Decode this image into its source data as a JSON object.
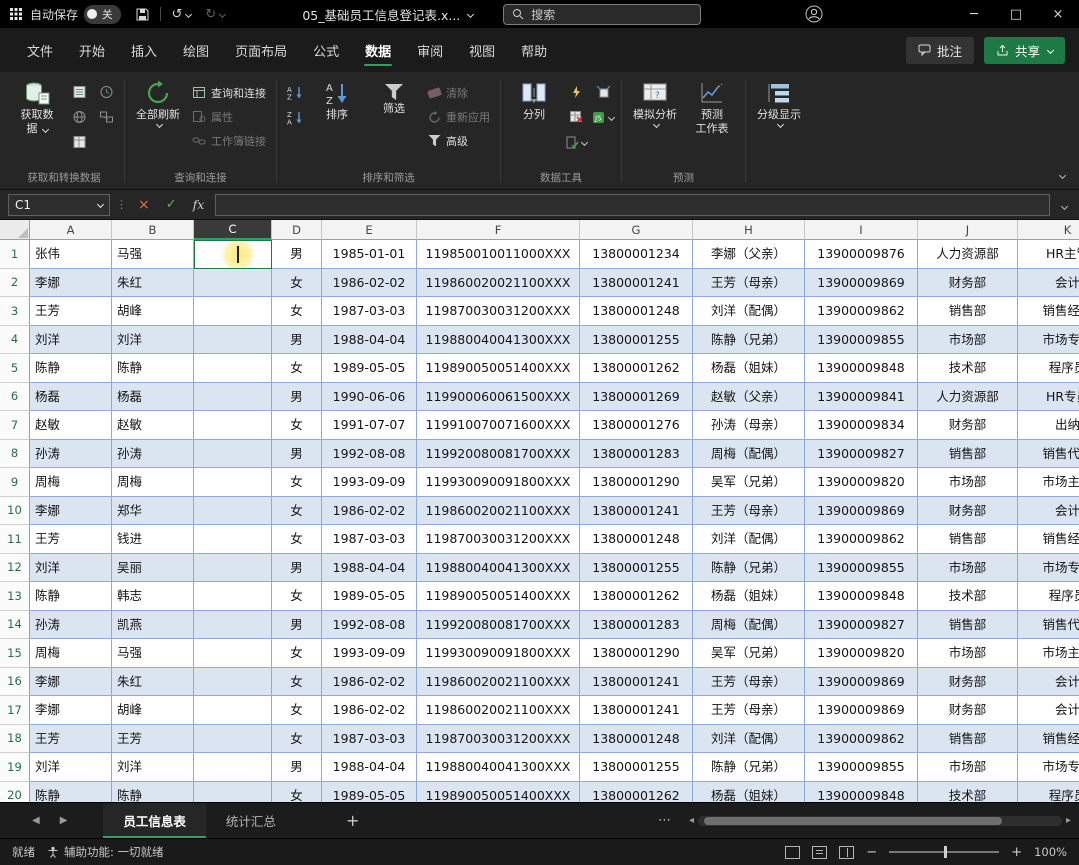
{
  "titlebar": {
    "autosave_label": "自动保存",
    "autosave_state": "关",
    "filename": "05_基础员工信息登记表.x...",
    "search_placeholder": "搜索"
  },
  "menu": {
    "tabs": [
      "文件",
      "开始",
      "插入",
      "绘图",
      "页面布局",
      "公式",
      "数据",
      "审阅",
      "视图",
      "帮助"
    ],
    "active_tab": "数据",
    "comments": "批注",
    "share": "共享"
  },
  "ribbon": {
    "group_labels": [
      "获取和转换数据",
      "查询和连接",
      "排序和筛选",
      "数据工具",
      "预测"
    ],
    "buttons": {
      "get_data_l1": "获取数",
      "get_data_l2": "据",
      "refresh_all": "全部刷新",
      "queries": "查询和连接",
      "properties": "属性",
      "workbook_links": "工作簿链接",
      "sort": "排序",
      "filter": "筛选",
      "clear": "清除",
      "reapply": "重新应用",
      "advanced": "高级",
      "text_to_columns": "分列",
      "what_if": "模拟分析",
      "forecast_l1": "预测",
      "forecast_l2": "工作表",
      "outline": "分级显示"
    }
  },
  "formula_bar": {
    "name_box": "C1",
    "name_box_menu": "⋮",
    "fx_label": "fx"
  },
  "glyphs": {
    "undo": "↺",
    "redo": "↻",
    "minimize": "─",
    "maximize": "□",
    "close": "×",
    "cancel": "×",
    "confirm": "✓",
    "more": "⋯",
    "tab_nav_left": "◀",
    "tab_nav_right": "▶",
    "scroll_left": "◂",
    "scroll_right": "▸",
    "zoom_out": "−",
    "zoom_in": "+",
    "add_sheet": "+"
  },
  "grid": {
    "columns": [
      "A",
      "B",
      "C",
      "D",
      "E",
      "F",
      "G",
      "H",
      "I",
      "J",
      "K"
    ],
    "active_cell": "C1",
    "rows": [
      [
        "张伟",
        "马强",
        "",
        "男",
        "1985-01-01",
        "119850010011000XXX",
        "13800001234",
        "李娜（父亲）",
        "13900009876",
        "人力资源部",
        "HR主管"
      ],
      [
        "李娜",
        "朱红",
        "",
        "女",
        "1986-02-02",
        "119860020021100XXX",
        "13800001241",
        "王芳（母亲）",
        "13900009869",
        "财务部",
        "会计"
      ],
      [
        "王芳",
        "胡峰",
        "",
        "女",
        "1987-03-03",
        "119870030031200XXX",
        "13800001248",
        "刘洋（配偶）",
        "13900009862",
        "销售部",
        "销售经理"
      ],
      [
        "刘洋",
        "刘洋",
        "",
        "男",
        "1988-04-04",
        "119880040041300XXX",
        "13800001255",
        "陈静（兄弟）",
        "13900009855",
        "市场部",
        "市场专员"
      ],
      [
        "陈静",
        "陈静",
        "",
        "女",
        "1989-05-05",
        "119890050051400XXX",
        "13800001262",
        "杨磊（姐妹）",
        "13900009848",
        "技术部",
        "程序员"
      ],
      [
        "杨磊",
        "杨磊",
        "",
        "男",
        "1990-06-06",
        "119900060061500XXX",
        "13800001269",
        "赵敏（父亲）",
        "13900009841",
        "人力资源部",
        "HR专员"
      ],
      [
        "赵敏",
        "赵敏",
        "",
        "女",
        "1991-07-07",
        "119910070071600XXX",
        "13800001276",
        "孙涛（母亲）",
        "13900009834",
        "财务部",
        "出纳"
      ],
      [
        "孙涛",
        "孙涛",
        "",
        "男",
        "1992-08-08",
        "119920080081700XXX",
        "13800001283",
        "周梅（配偶）",
        "13900009827",
        "销售部",
        "销售代表"
      ],
      [
        "周梅",
        "周梅",
        "",
        "女",
        "1993-09-09",
        "119930090091800XXX",
        "13800001290",
        "吴军（兄弟）",
        "13900009820",
        "市场部",
        "市场主管"
      ],
      [
        "李娜",
        "郑华",
        "",
        "女",
        "1986-02-02",
        "119860020021100XXX",
        "13800001241",
        "王芳（母亲）",
        "13900009869",
        "财务部",
        "会计"
      ],
      [
        "王芳",
        "钱进",
        "",
        "女",
        "1987-03-03",
        "119870030031200XXX",
        "13800001248",
        "刘洋（配偶）",
        "13900009862",
        "销售部",
        "销售经理"
      ],
      [
        "刘洋",
        "吴丽",
        "",
        "男",
        "1988-04-04",
        "119880040041300XXX",
        "13800001255",
        "陈静（兄弟）",
        "13900009855",
        "市场部",
        "市场专员"
      ],
      [
        "陈静",
        "韩志",
        "",
        "女",
        "1989-05-05",
        "119890050051400XXX",
        "13800001262",
        "杨磊（姐妹）",
        "13900009848",
        "技术部",
        "程序员"
      ],
      [
        "孙涛",
        "凯燕",
        "",
        "男",
        "1992-08-08",
        "119920080081700XXX",
        "13800001283",
        "周梅（配偶）",
        "13900009827",
        "销售部",
        "销售代表"
      ],
      [
        "周梅",
        "马强",
        "",
        "女",
        "1993-09-09",
        "119930090091800XXX",
        "13800001290",
        "吴军（兄弟）",
        "13900009820",
        "市场部",
        "市场主管"
      ],
      [
        "李娜",
        "朱红",
        "",
        "女",
        "1986-02-02",
        "119860020021100XXX",
        "13800001241",
        "王芳（母亲）",
        "13900009869",
        "财务部",
        "会计"
      ],
      [
        "李娜",
        "胡峰",
        "",
        "女",
        "1986-02-02",
        "119860020021100XXX",
        "13800001241",
        "王芳（母亲）",
        "13900009869",
        "财务部",
        "会计"
      ],
      [
        "王芳",
        "王芳",
        "",
        "女",
        "1987-03-03",
        "119870030031200XXX",
        "13800001248",
        "刘洋（配偶）",
        "13900009862",
        "销售部",
        "销售经理"
      ],
      [
        "刘洋",
        "刘洋",
        "",
        "男",
        "1988-04-04",
        "119880040041300XXX",
        "13800001255",
        "陈静（兄弟）",
        "13900009855",
        "市场部",
        "市场专员"
      ],
      [
        "陈静",
        "陈静",
        "",
        "女",
        "1989-05-05",
        "119890050051400XXX",
        "13800001262",
        "杨磊（姐妹）",
        "13900009848",
        "技术部",
        "程序员"
      ]
    ]
  },
  "sheet_bar": {
    "tabs": [
      "员工信息表",
      "统计汇总"
    ],
    "active_tab": "员工信息表"
  },
  "status_bar": {
    "ready": "就绪",
    "accessibility": "辅助功能: 一切就绪",
    "zoom": "100%"
  },
  "colors": {
    "accent_green": "#2ea35f",
    "share_button": "#1d7a44",
    "band_row": "#dbe5f1",
    "gridline": "#8ea9db",
    "click_halo": "#ffd700"
  }
}
